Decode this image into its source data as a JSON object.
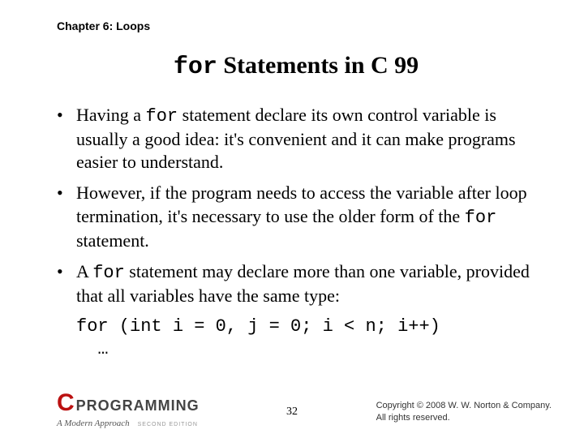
{
  "chapter": "Chapter 6: Loops",
  "title": {
    "code": "for",
    "rest": " Statements in C 99"
  },
  "bullets": [
    {
      "pre": "Having a ",
      "code": "for",
      "post": " statement declare its own control variable is usually a good idea: it's convenient and it can make programs easier to understand."
    },
    {
      "pre": "However, if the program needs to access the variable after loop termination, it's necessary to use the older form of the ",
      "code": "for",
      "post": " statement."
    },
    {
      "pre": "A ",
      "code": "for",
      "post": " statement may declare more than one variable, provided that all variables have the same type:"
    }
  ],
  "codeblock": "for (int i = 0, j = 0; i < n; i++)\n  …",
  "logo": {
    "c": "C",
    "prog": "PROGRAMMING",
    "sub": "A Modern Approach",
    "ed": "SECOND EDITION"
  },
  "pagenum": "32",
  "copyright": {
    "l1": "Copyright © 2008 W. W. Norton & Company.",
    "l2": "All rights reserved."
  }
}
